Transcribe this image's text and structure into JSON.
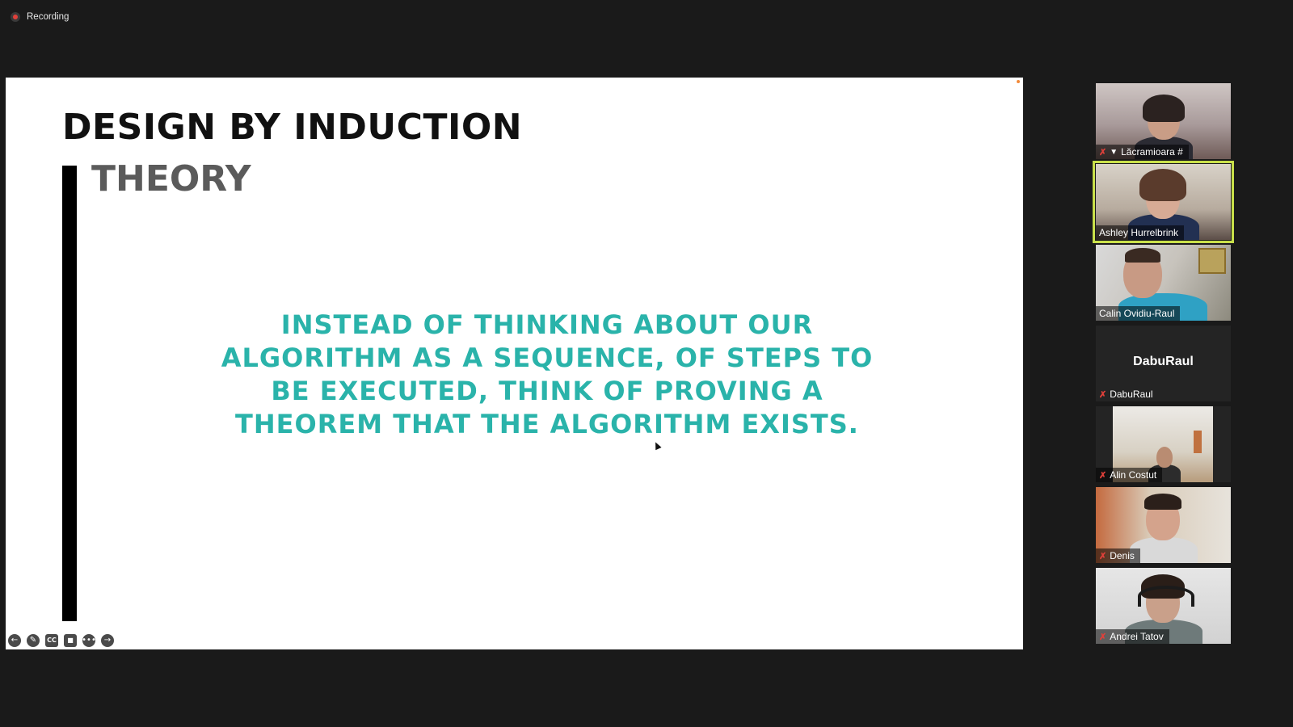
{
  "recording": {
    "label": "Recording"
  },
  "slide": {
    "title": "DESIGN BY INDUCTION",
    "subtitle": "THEORY",
    "body_lines": [
      "INSTEAD OF THINKING ABOUT  OUR",
      "ALGORITHM AS A SEQUENCE, OF STEPS TO",
      "BE EXECUTED,  THINK OF PROVING A",
      "THEOREM THAT THE ALGORITHM EXISTS."
    ],
    "colors": {
      "body": "#2ab3aa",
      "title": "#111111",
      "subtitle": "#5b5b5b"
    }
  },
  "slide_controls": [
    {
      "name": "previous-slide-icon",
      "glyph": "←"
    },
    {
      "name": "pen-icon",
      "glyph": "✎"
    },
    {
      "name": "captions-icon",
      "glyph": "CC"
    },
    {
      "name": "camera-icon",
      "glyph": "■"
    },
    {
      "name": "more-options-icon",
      "glyph": "•••"
    },
    {
      "name": "next-slide-icon",
      "glyph": "→"
    }
  ],
  "participants": [
    {
      "name": "Lăcramioara #",
      "muted": true,
      "pinned": true,
      "video": true
    },
    {
      "name": "Ashley Hurrelbrink",
      "muted": false,
      "pinned": false,
      "video": true,
      "active_speaker": true
    },
    {
      "name": "Calin Ovidiu-Raul",
      "muted": false,
      "pinned": false,
      "video": true
    },
    {
      "name": "DabuRaul",
      "muted": true,
      "pinned": false,
      "video": false,
      "display_name": "DabuRaul"
    },
    {
      "name": "Alin Costut",
      "muted": true,
      "pinned": false,
      "video": true
    },
    {
      "name": "Denis",
      "muted": true,
      "pinned": false,
      "video": true
    },
    {
      "name": "Andrei Tatov",
      "muted": true,
      "pinned": false,
      "video": true
    }
  ],
  "colors": {
    "active_speaker_border": "#c9e04a",
    "mute": "#e0403a",
    "background": "#1a1a1a"
  }
}
